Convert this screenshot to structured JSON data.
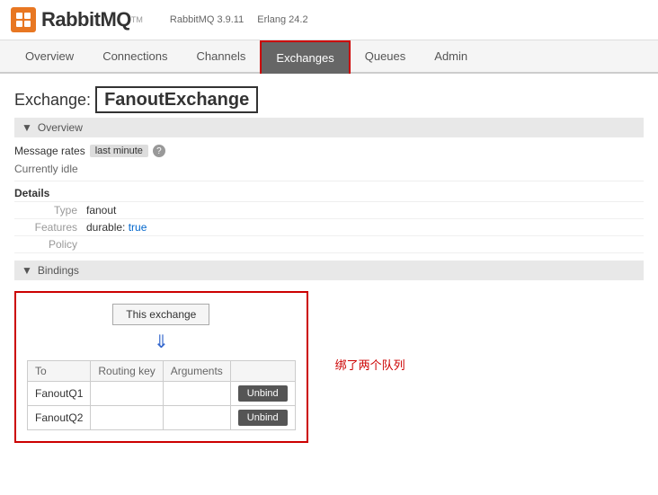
{
  "header": {
    "logo_text": "RabbitMQ",
    "logo_tm": "TM",
    "version": "RabbitMQ 3.9.11",
    "erlang": "Erlang 24.2"
  },
  "nav": {
    "items": [
      {
        "label": "Overview",
        "active": false
      },
      {
        "label": "Connections",
        "active": false
      },
      {
        "label": "Channels",
        "active": false
      },
      {
        "label": "Exchanges",
        "active": true
      },
      {
        "label": "Queues",
        "active": false
      },
      {
        "label": "Admin",
        "active": false
      }
    ]
  },
  "page": {
    "title_prefix": "Exchange:",
    "exchange_name": "FanoutExchange",
    "overview_section": "Overview",
    "message_rates_label": "Message rates",
    "message_rates_badge": "last minute",
    "message_rates_help": "?",
    "idle_text": "Currently idle",
    "details_label": "Details",
    "type_label": "Type",
    "type_value": "fanout",
    "features_label": "Features",
    "features_value": "durable:",
    "features_value2": "true",
    "policy_label": "Policy",
    "policy_value": "",
    "bindings_section": "Bindings",
    "this_exchange_btn": "This exchange",
    "down_arrow": "⇓",
    "table": {
      "headers": [
        "To",
        "Routing key",
        "Arguments"
      ],
      "rows": [
        {
          "to": "FanoutQ1",
          "routing_key": "",
          "arguments": "",
          "action": "Unbind"
        },
        {
          "to": "FanoutQ2",
          "routing_key": "",
          "arguments": "",
          "action": "Unbind"
        }
      ]
    },
    "side_note": "绑了两个队列"
  }
}
